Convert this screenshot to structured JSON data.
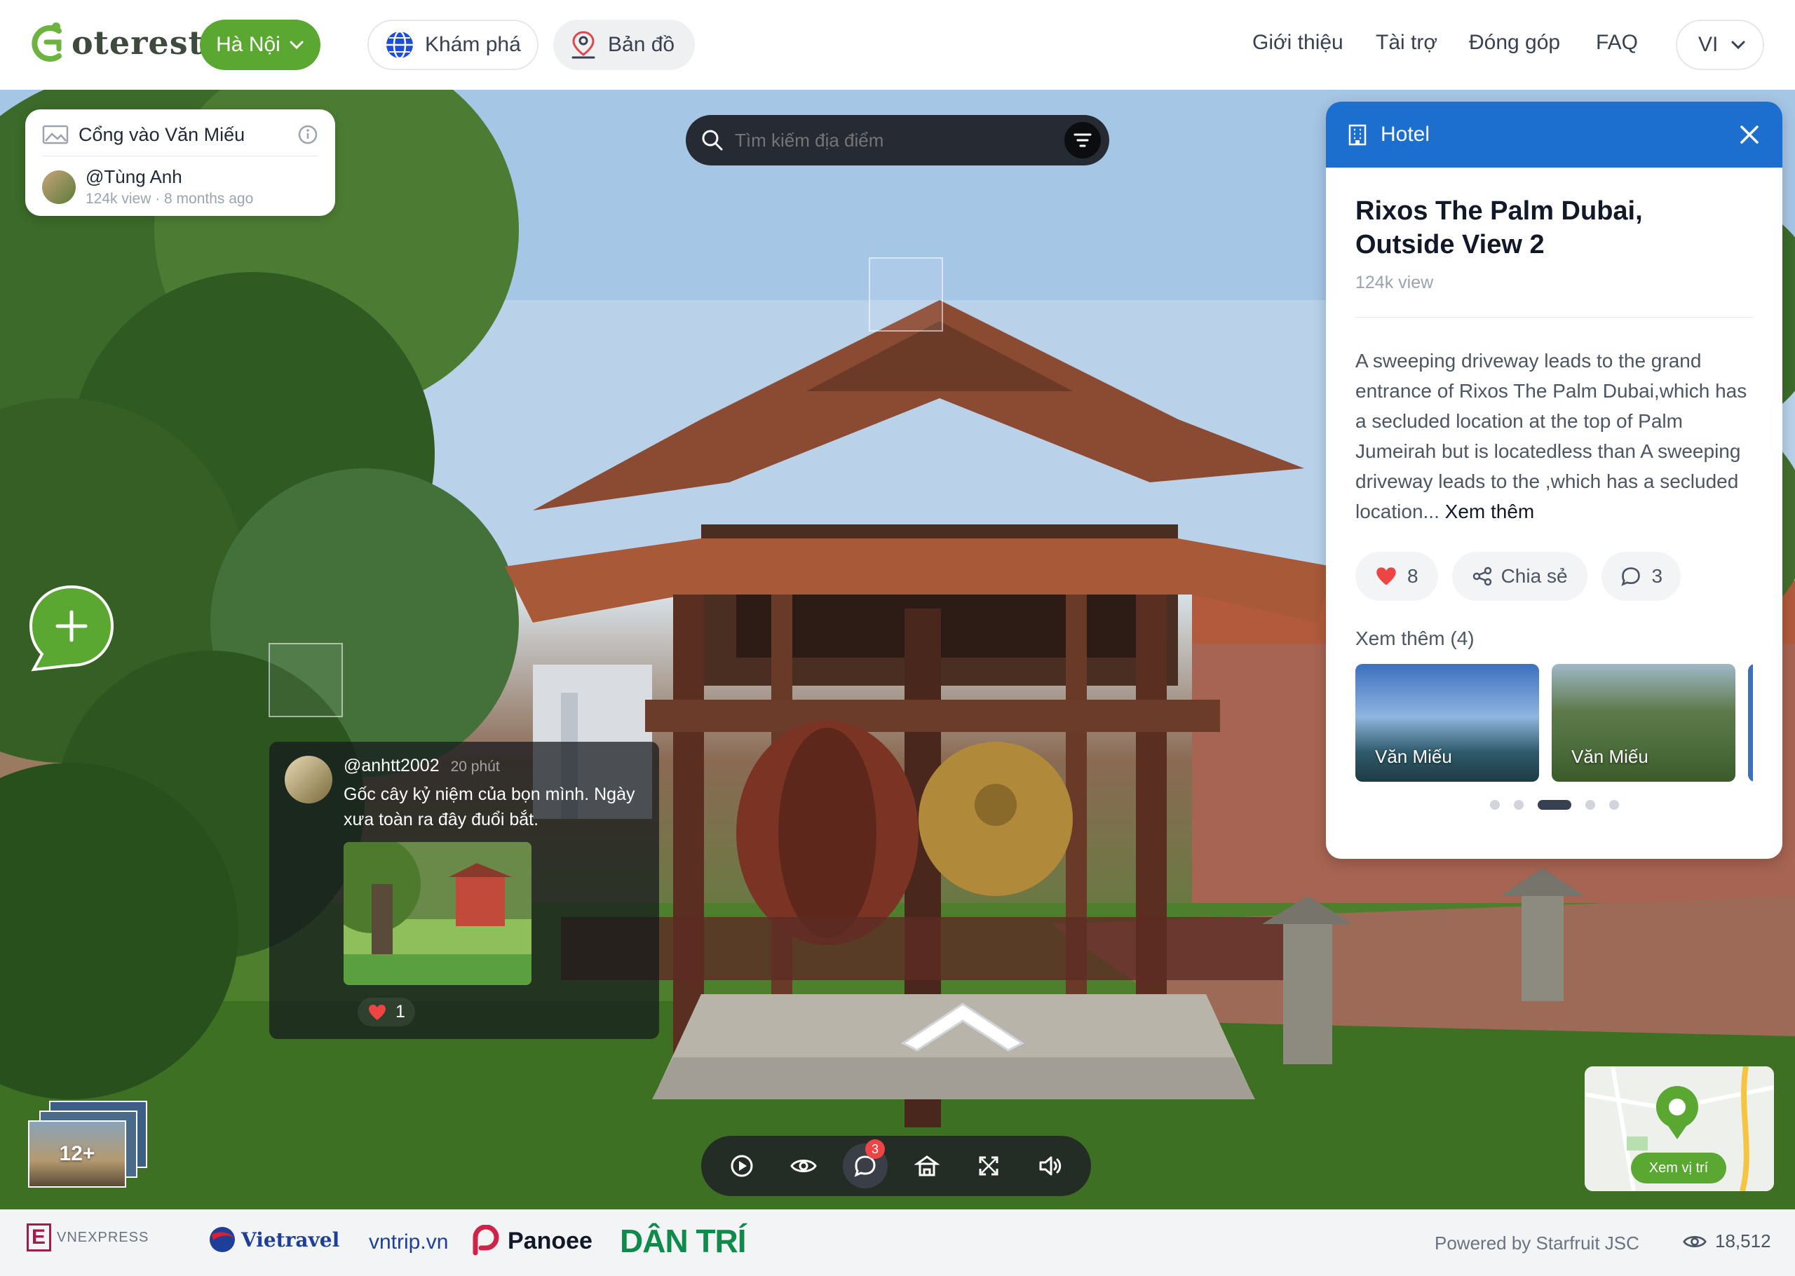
{
  "header": {
    "logo_text": "oterest",
    "city": "Hà Nội",
    "explore_label": "Khám phá",
    "map_label": "Bản đồ",
    "nav": [
      "Giới thiệu",
      "Tài trợ",
      "Đóng góp",
      "FAQ"
    ],
    "language": "VI"
  },
  "info_card": {
    "title": "Cổng vào Văn Miếu",
    "author": "@Tùng Anh",
    "meta": "124k view · 8 months ago"
  },
  "search": {
    "placeholder": "Tìm kiếm địa điểm"
  },
  "hotel_panel": {
    "category": "Hotel",
    "title": "Rixos The Palm Dubai, Outside View 2",
    "views": "124k view",
    "description": "A sweeping driveway leads to the grand entrance of Rixos The Palm Dubai,which has a secluded location at the top of Palm Jumeirah but is locatedless than A sweeping driveway leads to the ,which has a secluded location...",
    "read_more": "Xem thêm",
    "likes": "8",
    "share_label": "Chia sẻ",
    "comments": "3",
    "more_title": "Xem thêm (4)",
    "thumbnails": [
      {
        "label": "Văn Miếu"
      },
      {
        "label": "Văn Miếu"
      }
    ],
    "pagination": {
      "count": 5,
      "active_index": 2
    }
  },
  "comment": {
    "user": "@anhtt2002",
    "time": "20 phút",
    "text": "Gốc cây kỷ niệm của bọn mình. Ngày xưa toàn ra đây đuổi bắt.",
    "likes": "1"
  },
  "gallery": {
    "count_label": "12+"
  },
  "minimap": {
    "button_label": "Xem vị trí"
  },
  "toolbar": {
    "items": [
      "play-icon",
      "eye-icon",
      "comment-icon",
      "hotel-icon",
      "fullscreen-icon",
      "volume-icon"
    ],
    "comment_badge": "3"
  },
  "footer": {
    "partners": [
      "VNEXPRESS",
      "Vietravel",
      "vntrip.vn",
      "Panoee",
      "DÂN TRÍ"
    ],
    "powered_by": "Powered by Starfruit JSC",
    "view_count": "18,512"
  },
  "colors": {
    "brand_green": "#5aa832",
    "hotel_blue": "#1d6fcf",
    "heart_red": "#ef4444"
  }
}
